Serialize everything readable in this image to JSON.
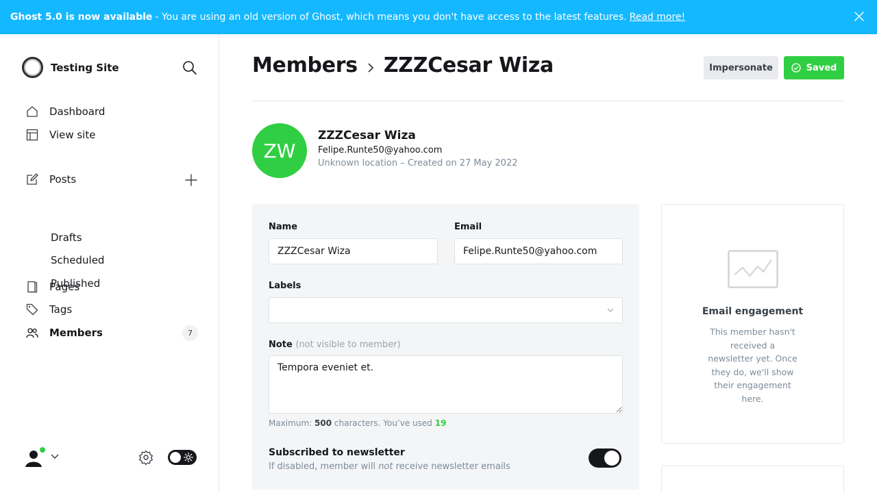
{
  "banner": {
    "title": "Ghost 5.0 is now available",
    "message": "- You are using an old version of Ghost, which means you don't have access to the latest features.",
    "link": "Read more!"
  },
  "sidebar": {
    "site_name": "Testing Site",
    "nav": {
      "dashboard": "Dashboard",
      "view_site": "View site",
      "posts": "Posts",
      "drafts": "Drafts",
      "scheduled": "Scheduled",
      "published": "Published",
      "pages": "Pages",
      "tags": "Tags",
      "members": "Members",
      "members_count": "7"
    }
  },
  "header": {
    "parent": "Members",
    "title": "ZZZCesar Wiza",
    "impersonate_label": "Impersonate",
    "saved_label": "Saved"
  },
  "member": {
    "initials": "ZW",
    "name": "ZZZCesar Wiza",
    "email": "Felipe.Runte50@yahoo.com",
    "meta": "Unknown location – Created on 27 May 2022"
  },
  "form": {
    "name_label": "Name",
    "name_value": "ZZZCesar Wiza",
    "email_label": "Email",
    "email_value": "Felipe.Runte50@yahoo.com",
    "labels_label": "Labels",
    "note_label": "Note",
    "note_muted": "(not visible to member)",
    "note_value": "Tempora eveniet et.",
    "hint_prefix": "Maximum:",
    "hint_max": "500",
    "hint_mid": "characters. You’ve used",
    "hint_used": "19",
    "newsletter_title": "Subscribed to newsletter",
    "newsletter_desc_pre": "If disabled, member will",
    "newsletter_desc_em": "not",
    "newsletter_desc_post": "receive newsletter emails",
    "newsletter_enabled": true
  },
  "engagement": {
    "title": "Email engagement",
    "description": "This member hasn't received a newsletter yet. Once they do, we'll show their engagement here."
  },
  "colors": {
    "banner": "#14b8ff",
    "accent_green": "#30cf43",
    "text": "#15171a"
  }
}
